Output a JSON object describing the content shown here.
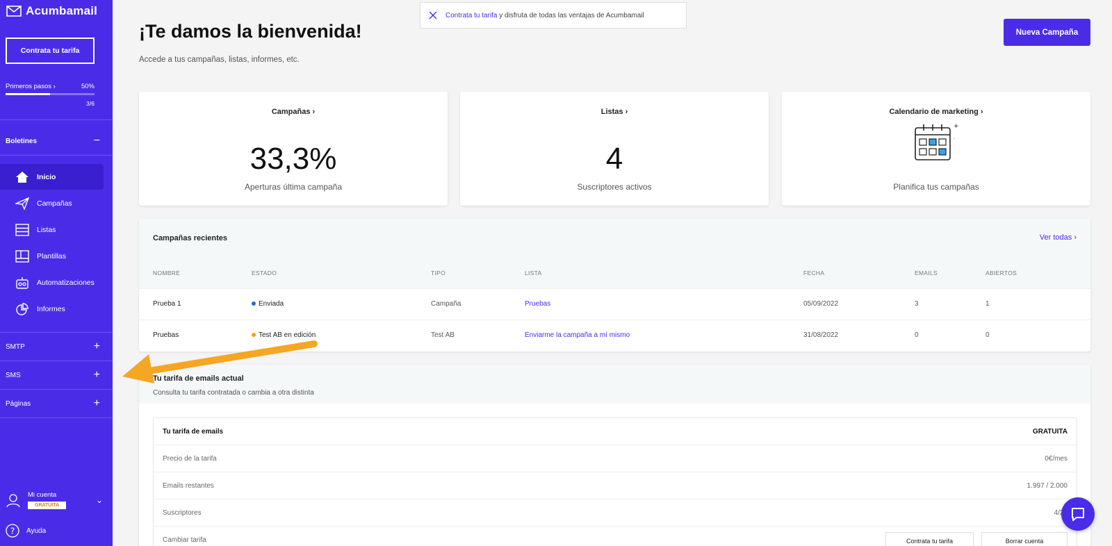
{
  "sidebar": {
    "brand": "Acumbamail",
    "contract_button": "Contrata tu tarifa",
    "progress": {
      "label": "Primeros pasos",
      "percent_text": "50%",
      "fraction": 0.5,
      "count": "3/6"
    },
    "newsletters_section": "Boletines",
    "items": [
      {
        "label": "Inicio",
        "icon": "home-icon",
        "active": true
      },
      {
        "label": "Campañas",
        "icon": "paper-plane-icon"
      },
      {
        "label": "Listas",
        "icon": "list-icon"
      },
      {
        "label": "Plantillas",
        "icon": "template-icon"
      },
      {
        "label": "Automatizaciones",
        "icon": "robot-icon"
      },
      {
        "label": "Informes",
        "icon": "chart-pie-icon"
      }
    ],
    "sections": [
      {
        "label": "SMTP"
      },
      {
        "label": "SMS"
      },
      {
        "label": "Páginas"
      }
    ],
    "account": {
      "label": "Mi cuenta",
      "plan": "GRATUITA"
    },
    "help": "Ayuda",
    "accent": "#4a2ce8"
  },
  "banner": {
    "link": "Contrata tu tarifa",
    "text": " y disfruta de todas las ventajas de Acumbamail"
  },
  "header": {
    "title": "¡Te damos la bienvenida!",
    "subtitle": "Accede a tus campañas, listas, informes, etc.",
    "new_campaign": "Nueva Campaña"
  },
  "cards": [
    {
      "title": "Campañas",
      "value": "33,3%",
      "caption": "Aperturas última campaña"
    },
    {
      "title": "Listas",
      "value": "4",
      "caption": "Suscriptores activos"
    },
    {
      "title": "Calendario de marketing",
      "caption": "Planifica tus campañas"
    }
  ],
  "recent": {
    "title": "Campañas recientes",
    "see_all": "Ver todas",
    "columns": [
      "NOMBRE",
      "ESTADO",
      "TIPO",
      "LISTA",
      "FECHA",
      "EMAILS",
      "ABIERTOS"
    ],
    "rows": [
      {
        "name": "Prueba 1",
        "status": "Enviada",
        "status_color": "#1d6fd1",
        "type": "Campaña",
        "list": "Pruebas",
        "date": "05/09/2022",
        "emails": "3",
        "opened": "1"
      },
      {
        "name": "Pruebas",
        "status": "Test AB en edición",
        "status_color": "#f5a000",
        "type": "Test AB",
        "list": "Enviarme la campaña a mí mismo",
        "date": "31/08/2022",
        "emails": "0",
        "opened": "0"
      }
    ]
  },
  "tariff": {
    "title": "Tu tarifa de emails actual",
    "subtitle": "Consulta tu tarifa contratada o cambia a otra distinta",
    "rows": [
      {
        "label": "Tu tarifa de emails",
        "value": "GRATUITA"
      },
      {
        "label": "Precio de la tarifa",
        "value": "0€/mes"
      },
      {
        "label": "Emails restantes",
        "value": "1.997 / 2.000"
      },
      {
        "label": "Suscriptores",
        "value": "4/25"
      },
      {
        "label": "Cambiar tarifa"
      }
    ],
    "buttons": {
      "contract": "Contrata tu tarifa",
      "delete": "Borrar cuenta"
    }
  }
}
